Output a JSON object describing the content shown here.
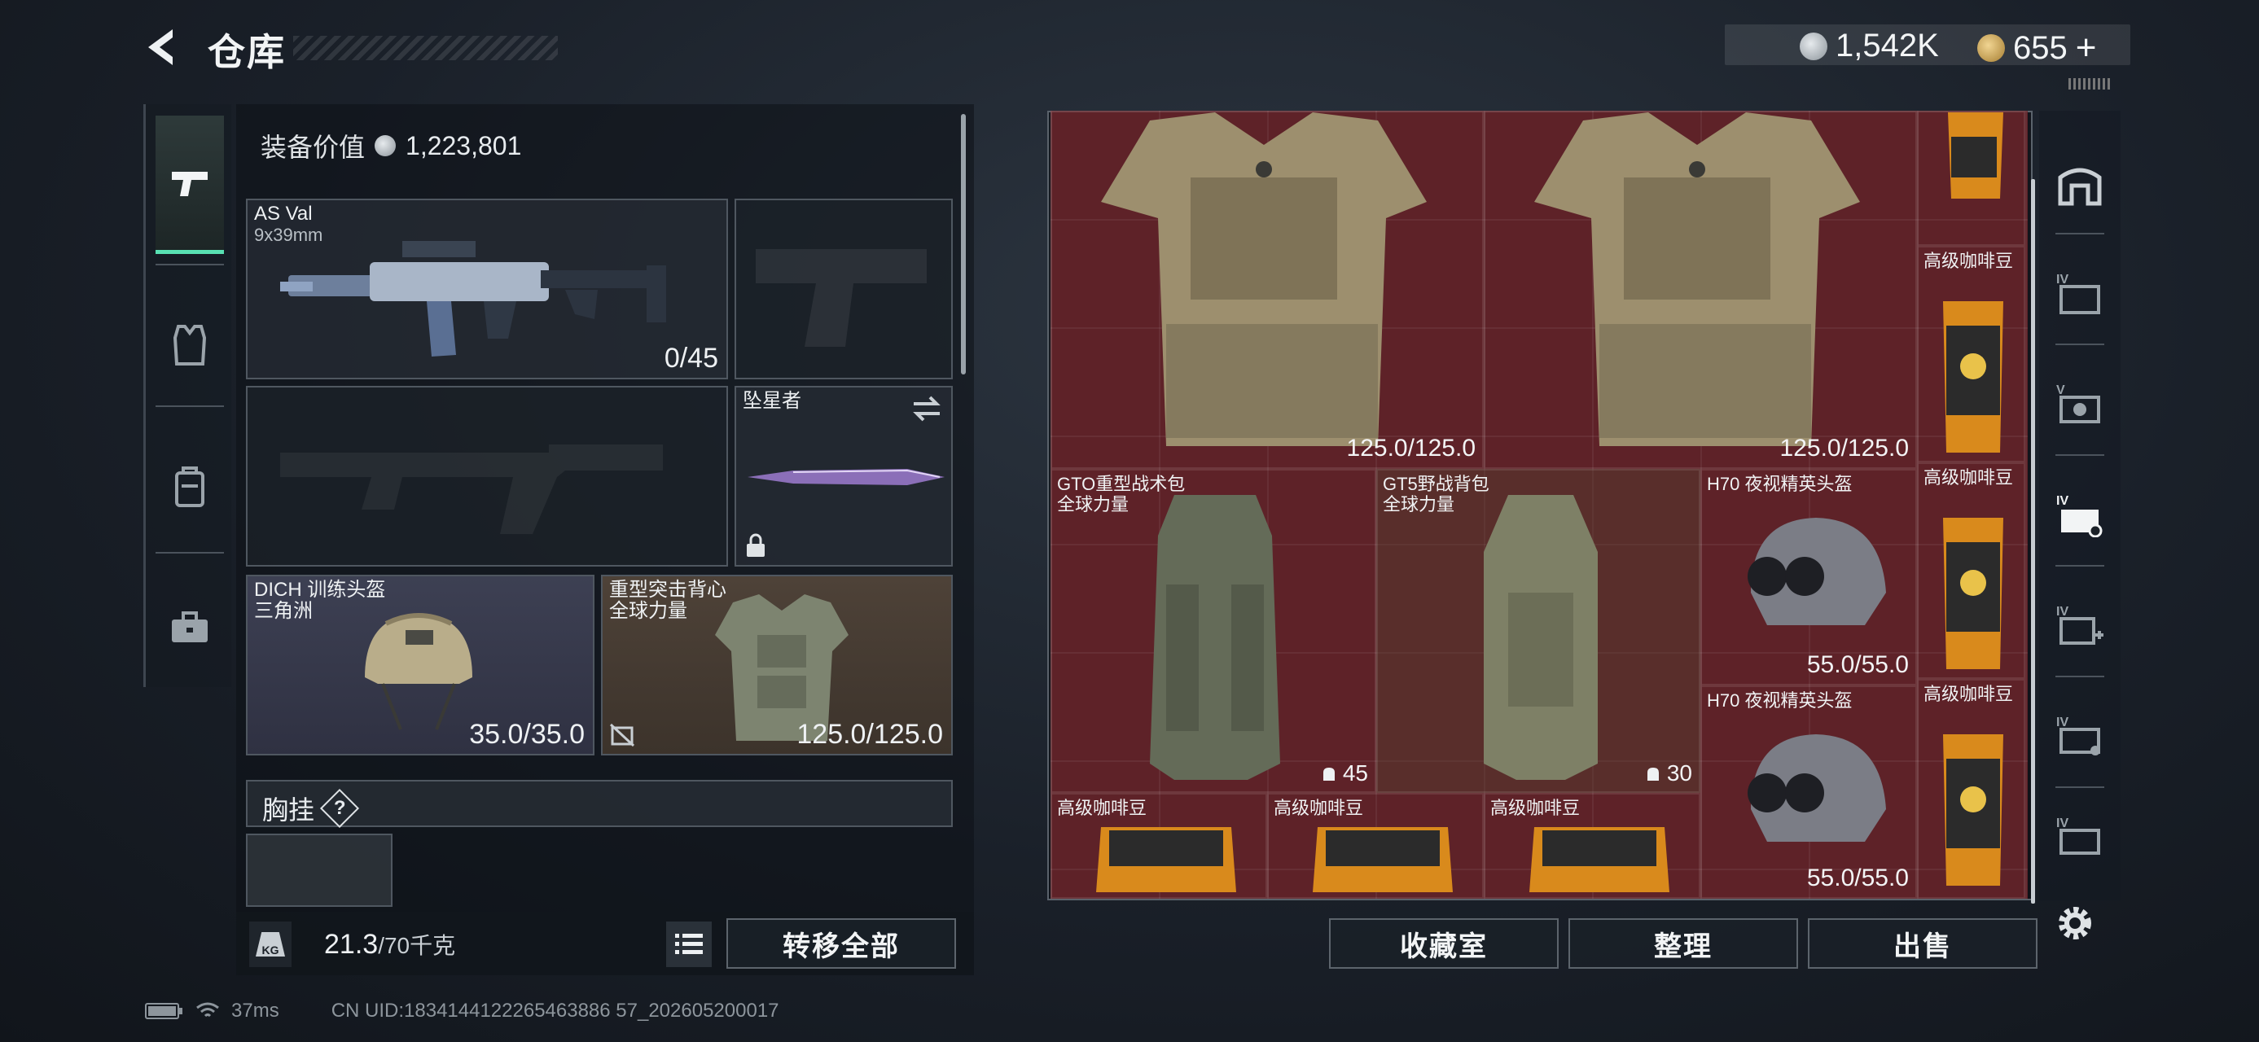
{
  "header": {
    "title": "仓库",
    "currencies": [
      {
        "icon": "silver-coin-icon",
        "value": "1,542K",
        "color": "#c9cfd4"
      },
      {
        "icon": "gold-coin-icon",
        "value": "655",
        "plus": "+",
        "color": "#c9a45c"
      }
    ]
  },
  "tabs": [
    {
      "icon": "pistol-icon",
      "active": true
    },
    {
      "icon": "armor-vest-icon",
      "active": false
    },
    {
      "icon": "backpack-icon",
      "active": false
    },
    {
      "icon": "toolbox-icon",
      "active": false
    }
  ],
  "equipment": {
    "value_label": "装备价值",
    "value": "1,223,801",
    "primary_weapon": {
      "name": "AS Val",
      "caliber": "9x39mm",
      "ammo": "0/45"
    },
    "melee": {
      "name": "坠星者"
    },
    "helmet": {
      "name": "DICH 训练头盔",
      "faction": "三角洲",
      "durability": "35.0/35.0"
    },
    "armor": {
      "name": "重型突击背心",
      "faction": "全球力量",
      "durability": "125.0/125.0"
    },
    "chest_rig": {
      "label": "胸挂",
      "help": "?"
    }
  },
  "weight": {
    "current": "21.3",
    "max": "/70千克",
    "icon_text": "KG"
  },
  "transfer_all_label": "转移全部",
  "inventory": {
    "armor_top_left": {
      "durability": "125.0/125.0"
    },
    "armor_top_right": {
      "durability": "125.0/125.0"
    },
    "bag_1": {
      "name": "GTO重型战术包",
      "faction": "全球力量",
      "count": "45"
    },
    "bag_2": {
      "name": "GT5野战背包",
      "faction": "全球力量",
      "count": "30"
    },
    "helmet_1": {
      "name": "H70 夜视精英头盔",
      "durability": "55.0/55.0"
    },
    "helmet_2": {
      "name": "H70 夜视精英头盔",
      "durability": "55.0/55.0"
    },
    "coffee_label": "高级咖啡豆"
  },
  "filters": [
    {
      "icon": "building-icon"
    },
    {
      "icon": "tier-iv-storage-icon"
    },
    {
      "icon": "tier-v-camera-icon"
    },
    {
      "icon": "tier-iv-case-icon",
      "active": true
    },
    {
      "icon": "tier-iv-medkit-icon"
    },
    {
      "icon": "tier-iv-ammo-icon"
    },
    {
      "icon": "tier-iv-crate-icon"
    }
  ],
  "bottom_buttons": {
    "collection": "收藏室",
    "sort": "整理",
    "sell": "出售"
  },
  "status": {
    "ping": "37ms",
    "uid": "CN UID:1834144122265463886 57_202605200017"
  }
}
